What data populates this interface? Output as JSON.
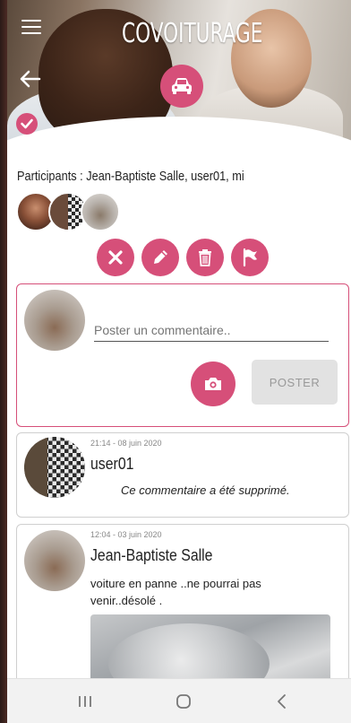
{
  "header": {
    "title": "COVOITURAGE"
  },
  "participants": {
    "text": "Participants : Jean-Baptiste Salle, user01, mi"
  },
  "new_comment": {
    "placeholder": "Poster un commentaire..",
    "post_label": "POSTER"
  },
  "comments": [
    {
      "timestamp": "21:14 - 08 juin 2020",
      "author": "user01",
      "text": "Ce commentaire a été supprimé."
    },
    {
      "timestamp": "12:04 - 03 juin 2020",
      "author": "Jean-Baptiste Salle",
      "text": "voiture en panne ..ne pourrai pas venir..désolé ."
    }
  ],
  "colors": {
    "accent": "#d64f79",
    "post_button_bg": "#e2e2e2"
  },
  "icons": {
    "menu": "hamburger-menu-icon",
    "back": "arrow-left-icon",
    "category": "car-icon",
    "check": "check-icon",
    "cancel": "close-icon",
    "edit": "pencil-icon",
    "delete": "trash-icon",
    "report": "flag-icon",
    "camera": "camera-icon"
  }
}
